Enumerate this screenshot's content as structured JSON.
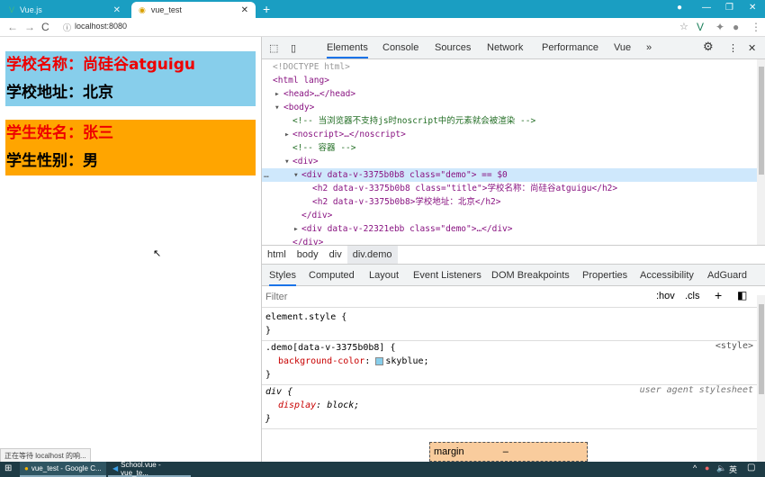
{
  "browser": {
    "tabs": [
      {
        "title": "Vue.js",
        "icon": "vue-icon"
      },
      {
        "title": "vue_test",
        "icon": "loading-icon"
      }
    ],
    "url": "localhost:8080",
    "status": "正在等待 localhost 的响..."
  },
  "page": {
    "school_name": "学校名称：尚硅谷atguigu",
    "school_address": "学校地址：北京",
    "student_name": "学生姓名：张三",
    "student_gender": "学生性别：男",
    "colors": {
      "school_bg": "#87ceeb",
      "student_bg": "#ffa500",
      "title": "#ee0000"
    }
  },
  "devtools": {
    "tabs": [
      "Elements",
      "Console",
      "Sources",
      "Network",
      "Performance",
      "Vue",
      "»"
    ],
    "active_tab": "Elements",
    "tree": [
      "<!DOCTYPE html>",
      "<html lang>",
      "<head>…</head>",
      "<body>",
      "<!-- 当浏览器不支持js时noscript中的元素就会被渲染 -->",
      "<noscript>…</noscript>",
      "<!-- 容器 -->",
      "<div>",
      "<div data-v-3375b0b8 class=\"demo\"> == $0",
      "<h2 data-v-3375b0b8 class=\"title\">学校名称：尚硅谷atguigu</h2>",
      "<h2 data-v-3375b0b8>学校地址：北京</h2>",
      "</div>",
      "<div data-v-22321ebb class=\"demo\">…</div>",
      "</div>"
    ],
    "breadcrumbs": [
      "html",
      "body",
      "div",
      "div.demo"
    ],
    "style_tabs": [
      "Styles",
      "Computed",
      "Layout",
      "Event Listeners",
      "DOM Breakpoints",
      "Properties",
      "Accessibility",
      "AdGuard"
    ],
    "filter_placeholder": "Filter",
    "hov": ":hov",
    "cls": ".cls",
    "rules": [
      {
        "selector": "element.style {",
        "close": "}"
      },
      {
        "selector": ".demo[data-v-3375b0b8] {",
        "source": "<style>",
        "prop": "background-color",
        "value": "skyblue;",
        "close": "}"
      },
      {
        "selector": "div {",
        "source": "user agent stylesheet",
        "prop": "display",
        "value": "block;",
        "close": "}"
      }
    ],
    "boxmodel": {
      "label": "margin",
      "value": "–"
    }
  },
  "taskbar": {
    "items": [
      "vue_test - Google C...",
      "School.vue - vue_te..."
    ],
    "lang": "英"
  }
}
